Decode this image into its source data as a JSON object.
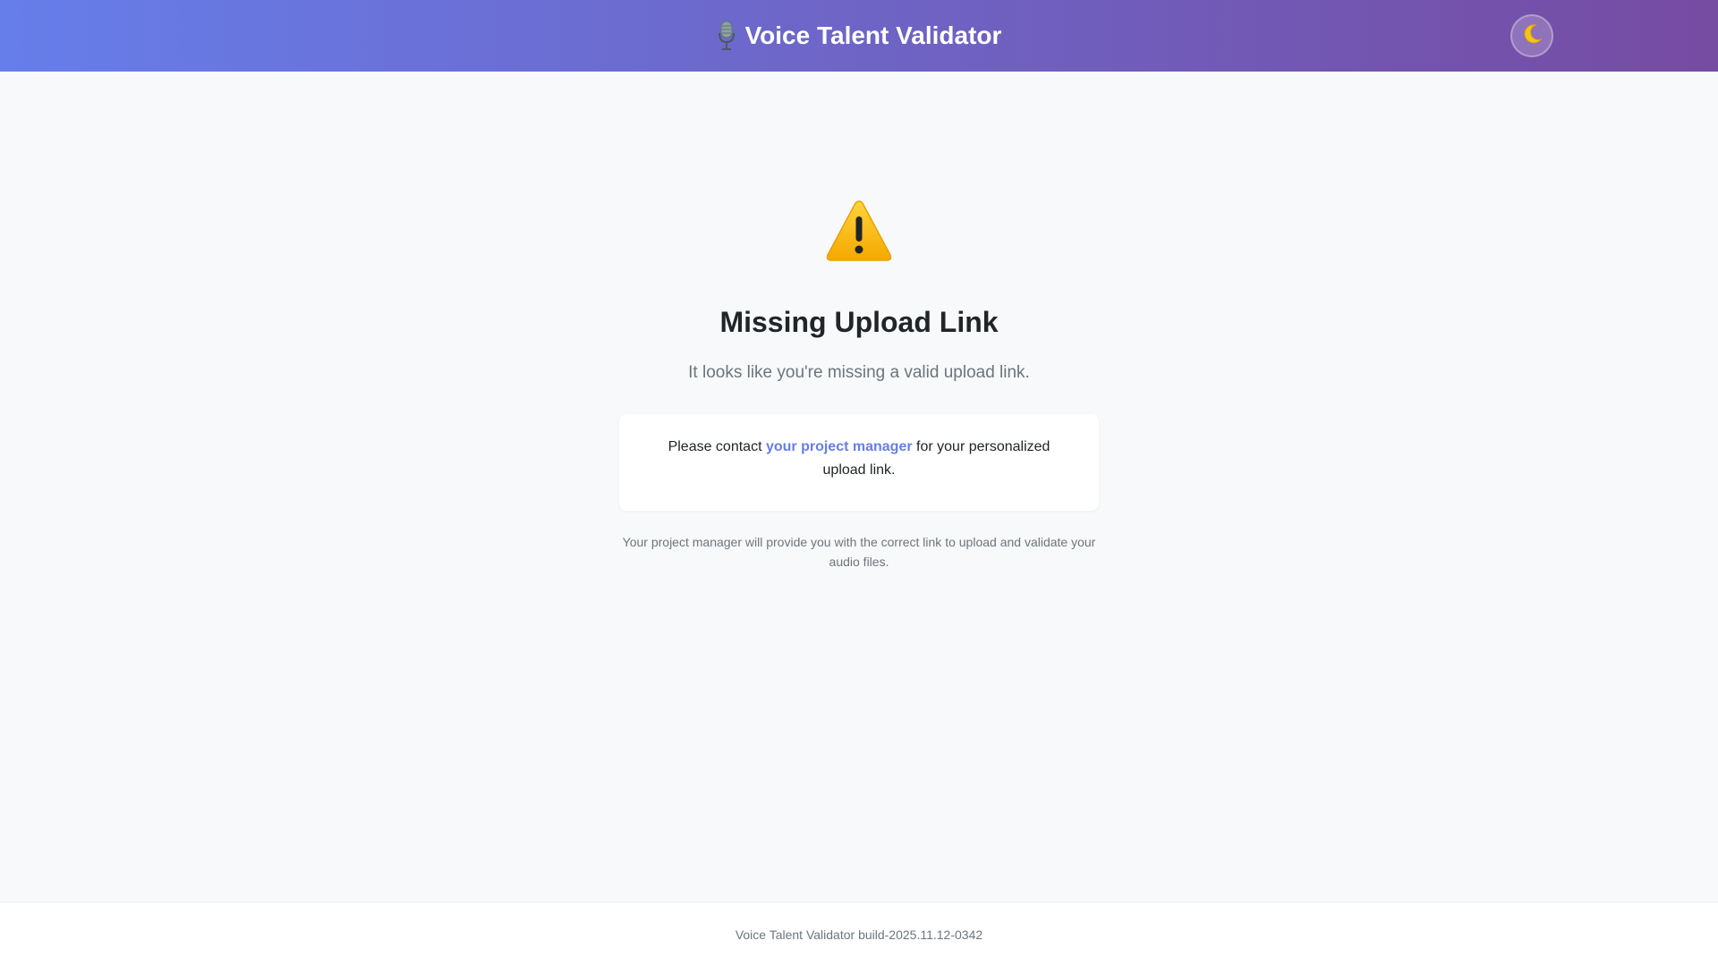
{
  "header": {
    "title": "Voice Talent Validator",
    "title_icon": "microphone-icon",
    "theme_toggle_icon": "moon-icon",
    "brand_gradient": [
      "#667eea",
      "#764ba2"
    ]
  },
  "main": {
    "status_icon": "warning-icon",
    "title": "Missing Upload Link",
    "subtitle": "It looks like you're missing a valid upload link.",
    "contact": {
      "prefix": "Please contact ",
      "link_text": "your project manager",
      "suffix": " for your personalized upload link."
    },
    "help_text": "Your project manager will provide you with the correct link to upload and validate your audio files."
  },
  "footer": {
    "text": "Voice Talent Validator build-2025.11.12-0342"
  },
  "colors": {
    "accent": "#667eea",
    "warning": "#f5b800",
    "text_primary": "#212529",
    "text_muted": "#6c757d",
    "background": "#f8f9fa"
  }
}
